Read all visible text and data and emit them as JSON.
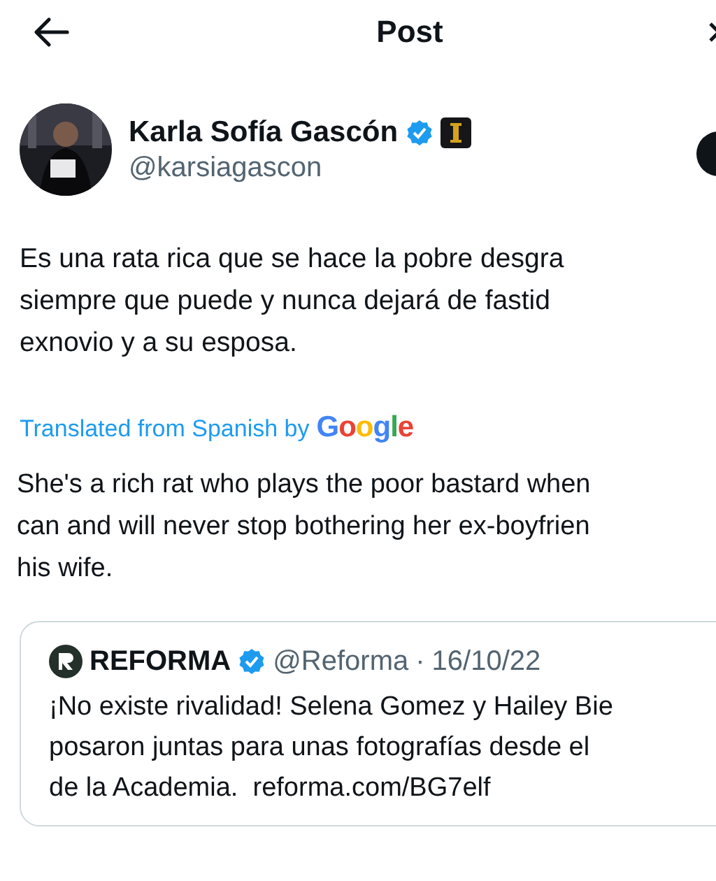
{
  "header": {
    "title": "Post"
  },
  "author": {
    "name": "Karla Sofía Gascón",
    "verified": true,
    "handle": "@karsiagascon"
  },
  "text_lines": [
    "Es una rata rica que se hace la pobre desgra",
    "siempre que puede y nunca dejará de fastid",
    "exnovio y a su esposa."
  ],
  "translation": {
    "label": "Translated from Spanish by",
    "brand": "Google",
    "lines": [
      "She's a rich rat who plays the poor bastard when",
      "can and will never stop bothering her ex-boyfrien",
      "his wife."
    ]
  },
  "quote": {
    "name": "REFORMA",
    "verified": true,
    "handle": "@Reforma",
    "separator": "·",
    "date": "16/10/22",
    "lines": [
      "¡No existe rivalidad! Selena Gomez y Hailey Bie",
      "posaron juntas para unas fotografías desde el",
      "de la Academia.  reforma.com/BG7elf"
    ]
  }
}
